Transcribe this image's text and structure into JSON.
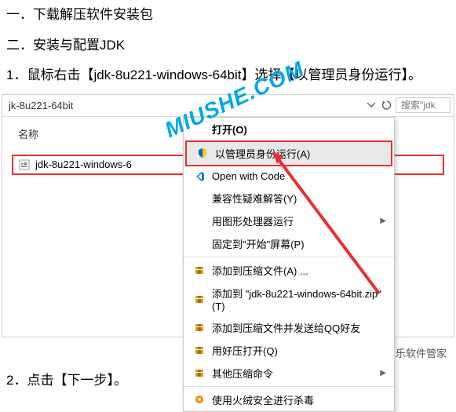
{
  "doc": {
    "line1": "一．下载解压软件安装包",
    "line2": "二．安装与配置JDK",
    "line3": "1．鼠标右击【jdk-8u221-windows-64bit】选择【以管理员身份运行】。",
    "line4": "2．点击【下一步】。"
  },
  "pathbar": {
    "path": "jk-8u221-64bit",
    "search_placeholder": "搜索\"jdk"
  },
  "column_header": "名称",
  "file": {
    "name": "jdk-8u221-windows-6"
  },
  "watermark_text": "MIUSHE.COM",
  "menu": {
    "open": "打开(O)",
    "run_admin": "以管理员身份运行(A)",
    "open_code": "Open with Code",
    "compat": "兼容性疑难解答(Y)",
    "gpu": "用图形处理器运行",
    "pin_start": "固定到\"开始\"屏幕(P)",
    "add_archive": "添加到压缩文件(A) ...",
    "add_zip": "添加到 \"jdk-8u221-windows-64bit.zip\"(T)",
    "add_qq": "添加到压缩文件并发送给QQ好友",
    "open_haozip": "用好压打开(Q)",
    "other_compress": "其他压缩命令",
    "cut_line": "使用火绒安全进行杀毒"
  },
  "footer": {
    "brand": "乐乐软件管家"
  }
}
